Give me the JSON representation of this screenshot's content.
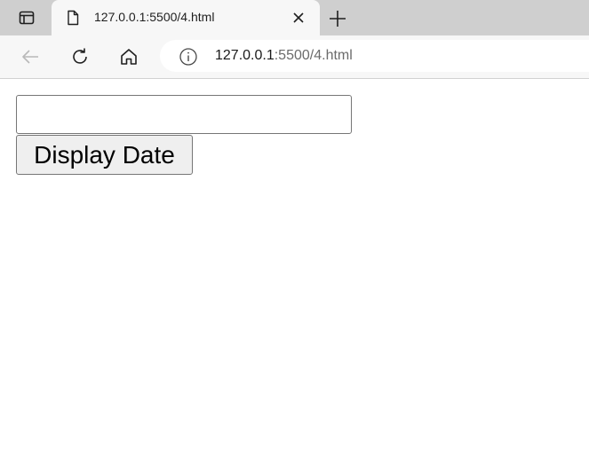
{
  "browser": {
    "tab": {
      "title": "127.0.0.1:5500/4.html",
      "favicon": "page-icon",
      "close_icon": "close-icon"
    },
    "tab_actions_icon": "tab-actions-icon",
    "new_tab_icon": "plus-icon",
    "toolbar": {
      "back_icon": "back-arrow-icon",
      "reload_icon": "reload-icon",
      "home_icon": "home-icon",
      "site_info_icon": "info-icon"
    },
    "address_bar": {
      "host": "127.0.0.1",
      "path": ":5500/4.html"
    }
  },
  "page": {
    "date_input": {
      "value": "",
      "placeholder": ""
    },
    "display_button": {
      "label": "Display Date"
    }
  },
  "colors": {
    "tabstrip_bg": "#cfcfcf",
    "toolbar_bg": "#f7f7f7",
    "button_bg": "#efefef",
    "url_path": "#6b6b6b"
  }
}
